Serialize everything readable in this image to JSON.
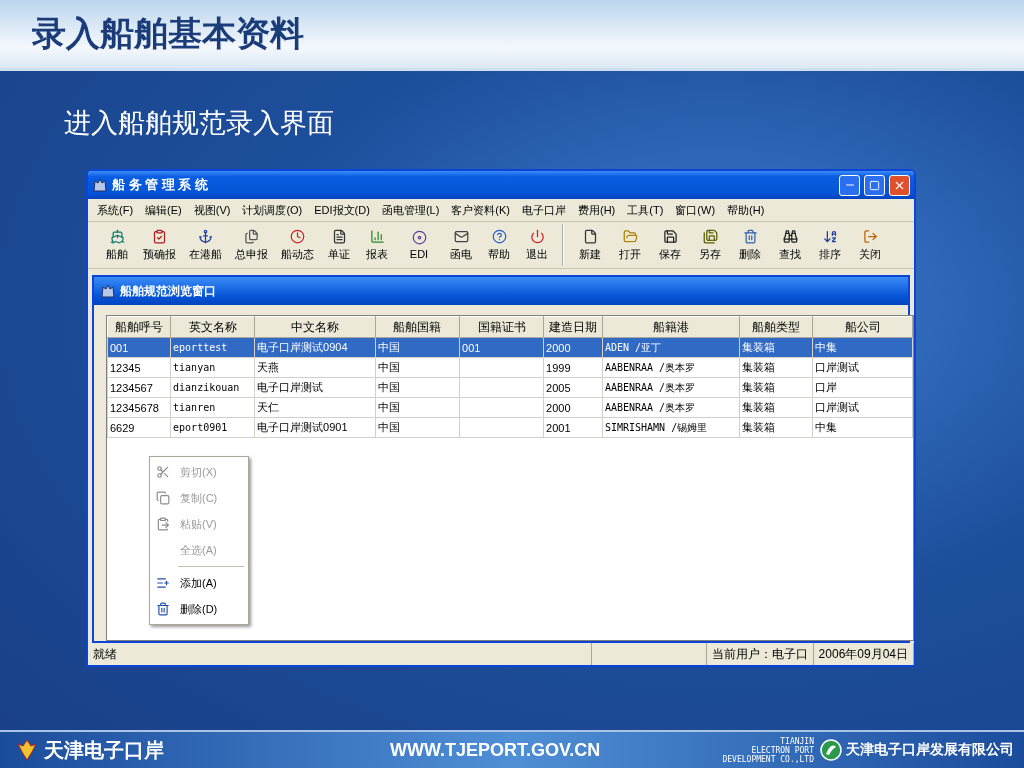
{
  "slide": {
    "title": "录入船舶基本资料",
    "subtitle": "进入船舶规范录入界面"
  },
  "window": {
    "title": "船 务 管 理 系 统",
    "menu": [
      "系统(F)",
      "编辑(E)",
      "视图(V)",
      "计划调度(O)",
      "EDI报文(D)",
      "函电管理(L)",
      "客户资料(K)",
      "电子口岸",
      "费用(H)",
      "工具(T)",
      "窗口(W)",
      "帮助(H)"
    ],
    "toolbar": [
      [
        "船舶",
        "预确报",
        "在港船",
        "总申报",
        "船动态",
        "单证",
        "报表",
        "EDI",
        "函电",
        "帮助",
        "退出"
      ],
      [
        "新建",
        "打开",
        "保存",
        "另存",
        "删除",
        "查找",
        "排序",
        "关闭"
      ]
    ],
    "child": {
      "title": "船舶规范浏览窗口",
      "table": {
        "columns": [
          "船舶呼号",
          "英文名称",
          "中文名称",
          "船舶国籍",
          "国籍证书",
          "建造日期",
          "船籍港",
          "船舶类型",
          "船公司"
        ],
        "rows": [
          {
            "selected": true,
            "cells": [
              "001",
              "eporttest",
              "电子口岸测试0904",
              "中国",
              "001",
              "2000",
              "ADEN /亚丁",
              "集装箱",
              "中集"
            ]
          },
          {
            "selected": false,
            "cells": [
              "12345",
              "tianyan",
              "天燕",
              "中国",
              "",
              "1999",
              "AABENRAA /奥本罗",
              "集装箱",
              "口岸测试"
            ]
          },
          {
            "selected": false,
            "cells": [
              "1234567",
              "dianzikouan",
              "电子口岸测试",
              "中国",
              "",
              "2005",
              "AABENRAA /奥本罗",
              "集装箱",
              "口岸"
            ]
          },
          {
            "selected": false,
            "cells": [
              "12345678",
              "tianren",
              "天仁",
              "中国",
              "",
              "2000",
              "AABENRAA /奥本罗",
              "集装箱",
              "口岸测试"
            ]
          },
          {
            "selected": false,
            "cells": [
              "6629",
              "eport0901",
              "电子口岸测试0901",
              "中国",
              "",
              "2001",
              "SIMRISHAMN /锡姆里",
              "集装箱",
              "中集"
            ]
          }
        ]
      }
    },
    "context_menu": [
      {
        "kind": "command",
        "label": "剪切(X)",
        "disabled": true
      },
      {
        "kind": "command",
        "label": "复制(C)",
        "disabled": true
      },
      {
        "kind": "command",
        "label": "粘贴(V)",
        "disabled": true
      },
      {
        "kind": "command",
        "label": "全选(A)",
        "disabled": true
      },
      {
        "kind": "separator"
      },
      {
        "kind": "command",
        "label": "添加(A)",
        "disabled": false
      },
      {
        "kind": "command",
        "label": "删除(D)",
        "disabled": false
      }
    ],
    "status_bar": [
      "就绪",
      "当前用户：电子口",
      "2006年09月04日"
    ]
  },
  "footer": {
    "logo_text": "天津电子口岸",
    "url": "WWW.TJEPORT.GOV.CN",
    "english_name": [
      "TIANJIN",
      "ELECTRON PORT",
      "DEVELOPMENT CO.,LTD"
    ],
    "company": "天津电子口岸发展有限公司"
  }
}
